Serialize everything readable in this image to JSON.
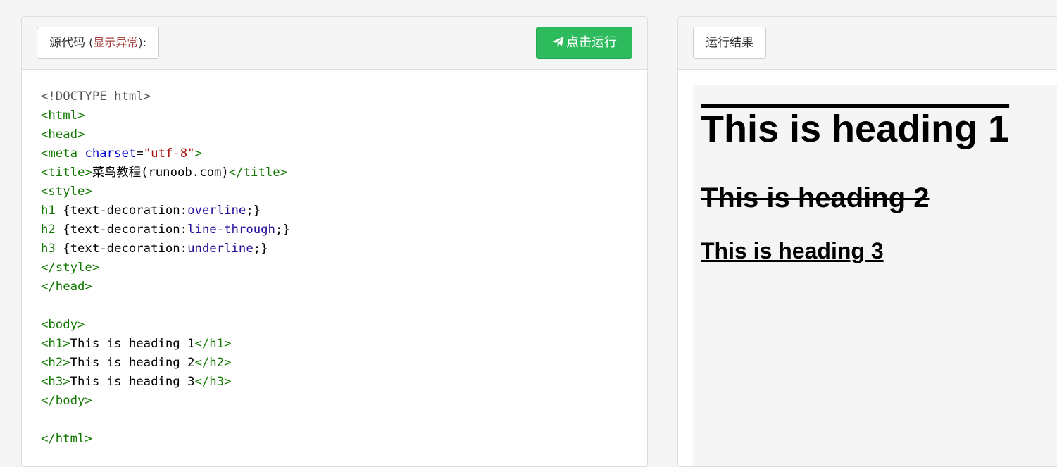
{
  "editor": {
    "source_label": "源代码",
    "paren_open": " (",
    "error_label": "显示异常",
    "paren_close": "):",
    "run_label": "点击运行",
    "run_icon": "paper-plane-icon",
    "code_lines": [
      [
        {
          "c": "t-doc",
          "t": "<!DOCTYPE html>"
        }
      ],
      [
        {
          "c": "t-tag",
          "t": "<html>"
        }
      ],
      [
        {
          "c": "t-tag",
          "t": "<head>"
        }
      ],
      [
        {
          "c": "t-tag",
          "t": "<meta "
        },
        {
          "c": "t-attr",
          "t": "charset"
        },
        {
          "c": "t-txt",
          "t": "="
        },
        {
          "c": "t-str",
          "t": "\"utf-8\""
        },
        {
          "c": "t-tag",
          "t": ">"
        }
      ],
      [
        {
          "c": "t-tag",
          "t": "<title>"
        },
        {
          "c": "t-txt",
          "t": "菜鸟教程(runoob.com)"
        },
        {
          "c": "t-tag",
          "t": "</title>"
        }
      ],
      [
        {
          "c": "t-tag",
          "t": "<style>"
        }
      ],
      [
        {
          "c": "t-tag",
          "t": "h1"
        },
        {
          "c": "t-txt",
          "t": " {text-decoration:"
        },
        {
          "c": "t-val",
          "t": "overline"
        },
        {
          "c": "t-txt",
          "t": ";}"
        }
      ],
      [
        {
          "c": "t-tag",
          "t": "h2"
        },
        {
          "c": "t-txt",
          "t": " {text-decoration:"
        },
        {
          "c": "t-val",
          "t": "line-through"
        },
        {
          "c": "t-txt",
          "t": ";}"
        }
      ],
      [
        {
          "c": "t-tag",
          "t": "h3"
        },
        {
          "c": "t-txt",
          "t": " {text-decoration:"
        },
        {
          "c": "t-val",
          "t": "underline"
        },
        {
          "c": "t-txt",
          "t": ";}"
        }
      ],
      [
        {
          "c": "t-tag",
          "t": "</style>"
        }
      ],
      [
        {
          "c": "t-tag",
          "t": "</head>"
        }
      ],
      [],
      [
        {
          "c": "t-tag",
          "t": "<body>"
        }
      ],
      [
        {
          "c": "t-tag",
          "t": "<h1>"
        },
        {
          "c": "t-txt",
          "t": "This is heading 1"
        },
        {
          "c": "t-tag",
          "t": "</h1>"
        }
      ],
      [
        {
          "c": "t-tag",
          "t": "<h2>"
        },
        {
          "c": "t-txt",
          "t": "This is heading 2"
        },
        {
          "c": "t-tag",
          "t": "</h2>"
        }
      ],
      [
        {
          "c": "t-tag",
          "t": "<h3>"
        },
        {
          "c": "t-txt",
          "t": "This is heading 3"
        },
        {
          "c": "t-tag",
          "t": "</h3>"
        }
      ],
      [
        {
          "c": "t-tag",
          "t": "</body>"
        }
      ],
      [],
      [
        {
          "c": "t-tag",
          "t": "</html>"
        }
      ]
    ]
  },
  "result": {
    "label": "运行结果",
    "h1": "This is heading 1",
    "h2": "This is heading 2",
    "h3": "This is heading 3"
  },
  "colors": {
    "run_button": "#2dbb5d",
    "tag": "#117700",
    "attribute": "#0000cc",
    "string": "#aa1111",
    "css_value": "#221199",
    "error_text": "#a94442"
  }
}
